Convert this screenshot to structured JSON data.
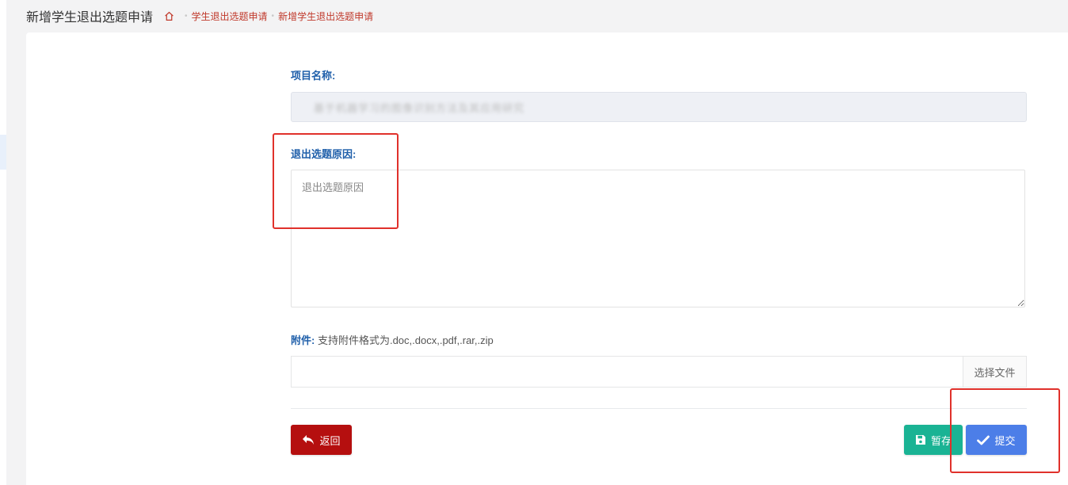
{
  "header": {
    "title": "新增学生退出选题申请",
    "breadcrumb": [
      "学生退出选题申请",
      "新增学生退出选题申请"
    ]
  },
  "form": {
    "project_name": {
      "label": "项目名称:",
      "value": "基于机器学习的图像识别方法及其应用研究"
    },
    "reason": {
      "label": "退出选题原因:",
      "placeholder": "退出选题原因",
      "value": ""
    },
    "attachment": {
      "label": "附件:",
      "hint": "支持附件格式为.doc,.docx,.pdf,.rar,.zip",
      "choose_label": "选择文件"
    }
  },
  "actions": {
    "back_label": "返回",
    "save_label": "暂存",
    "submit_label": "提交"
  },
  "colors": {
    "label": "#1f5faa",
    "breadcrumb": "#c0392b",
    "back_button": "#b50f0f",
    "save_button": "#1ab394",
    "submit_button": "#4c7ee8",
    "annotation": "#e0312b"
  }
}
